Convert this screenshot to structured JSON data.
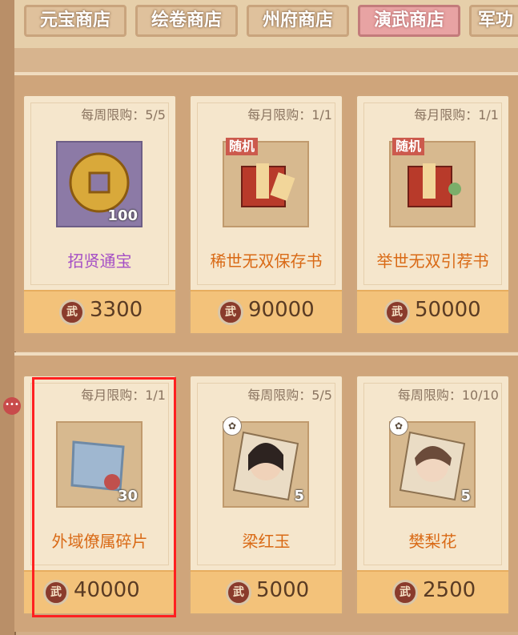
{
  "tabs": [
    {
      "label": "元宝商店",
      "active": false
    },
    {
      "label": "绘卷商店",
      "active": false
    },
    {
      "label": "州府商店",
      "active": false
    },
    {
      "label": "演武商店",
      "active": true
    },
    {
      "label": "军功",
      "active": false
    }
  ],
  "currency_icon_label": "武",
  "side_bubble": "•••",
  "shelves": [
    {
      "items": [
        {
          "limit": "每周限购：5/5",
          "name": "招贤通宝",
          "qty": "100",
          "price": "3300",
          "badge": "",
          "icon": "coin-icon",
          "name_color": "purple"
        },
        {
          "limit": "每月限购：1/1",
          "name": "稀世无双保存书",
          "qty": "",
          "price": "90000",
          "badge": "随机",
          "icon": "scroll-pack-icon",
          "name_color": "orange"
        },
        {
          "limit": "每月限购：1/1",
          "name": "举世无双引荐书",
          "qty": "",
          "price": "50000",
          "badge": "随机",
          "icon": "scroll-pack-icon",
          "name_color": "orange"
        }
      ]
    },
    {
      "items": [
        {
          "limit": "每月限购：1/1",
          "name": "外域僚属碎片",
          "qty": "30",
          "price": "40000",
          "badge": "",
          "icon": "fragment-icon",
          "name_color": "orange"
        },
        {
          "limit": "每周限购：5/5",
          "name": "梁红玉",
          "qty": "5",
          "price": "5000",
          "badge": "fan",
          "icon": "hero-portrait-icon",
          "name_color": "orange"
        },
        {
          "limit": "每周限购：10/10",
          "name": "樊梨花",
          "qty": "5",
          "price": "2500",
          "badge": "fan",
          "icon": "hero-portrait-icon",
          "name_color": "orange"
        }
      ]
    }
  ]
}
